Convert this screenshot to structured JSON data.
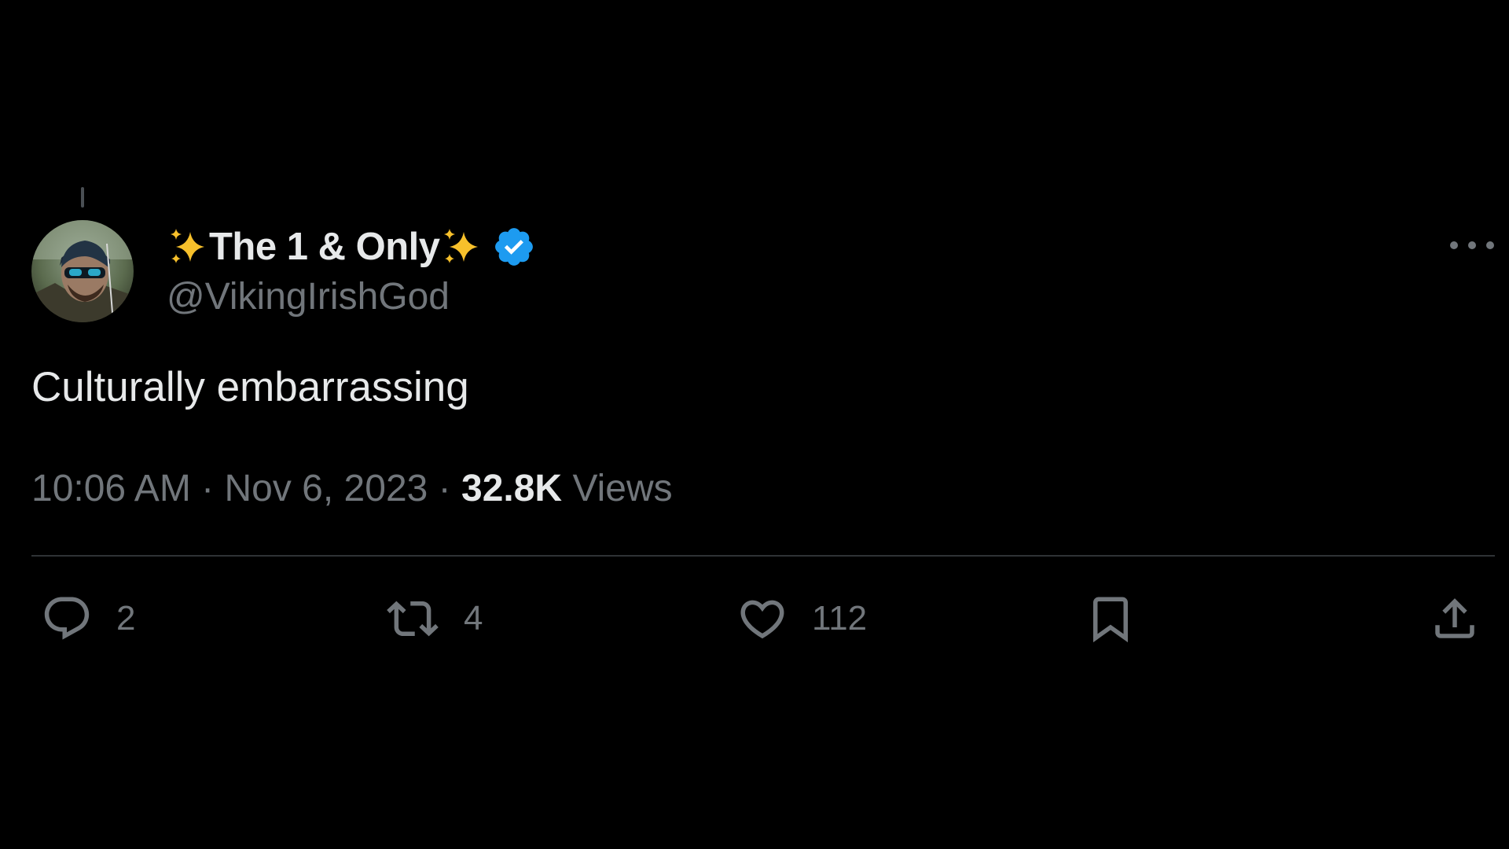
{
  "tweet": {
    "display_name": "The 1 & Only",
    "display_name_emoji_left": "sparkles-icon",
    "display_name_emoji_right": "sparkles-icon",
    "verified": true,
    "handle": "@VikingIrishGod",
    "text": "Culturally embarrassing",
    "time": "10:06 AM",
    "separator": "·",
    "date": "Nov 6, 2023",
    "views_count": "32.8K",
    "views_label": "Views"
  },
  "actions": {
    "reply_count": "2",
    "retweet_count": "4",
    "like_count": "112"
  },
  "icons": {
    "more": "more-icon",
    "reply": "reply-icon",
    "retweet": "retweet-icon",
    "like": "heart-icon",
    "bookmark": "bookmark-icon",
    "share": "share-icon",
    "verified": "verified-badge-icon"
  },
  "colors": {
    "background": "#000000",
    "primary_text": "#e7e9ea",
    "secondary_text": "#71767b",
    "divider": "#2f3336",
    "verified_blue": "#1d9bf0",
    "sparkle_gold": "#f7c02b"
  }
}
